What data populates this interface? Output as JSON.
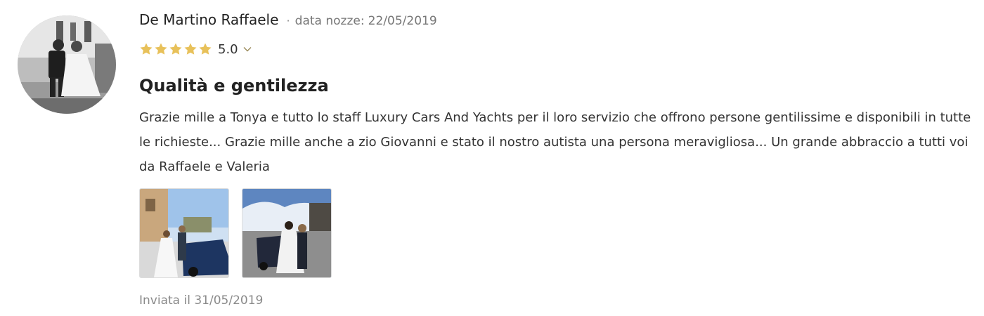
{
  "review": {
    "author": "De Martino Raffaele",
    "separator": "·",
    "wedding_label": "data nozze:",
    "wedding_date": "22/05/2019",
    "rating": "5.0",
    "stars": 5,
    "star_color": "#E8C15A",
    "title": "Qualità e gentilezza",
    "body": "Grazie mille a Tonya e tutto lo staff Luxury Cars And Yachts per il loro servizio che offrono persone gentilissime e disponibili in tutte le richieste... Grazie mille anche a zio Giovanni e stato il nostro autista una persona meravigliosa... Un grande abbraccio a tutti voi da Raffaele e Valeria",
    "sent_label": "Inviata il",
    "sent_date": "31/05/2019",
    "photos": [
      "wedding-couple-car-photo",
      "wedding-couple-street-photo"
    ],
    "avatar": "avatar-photo"
  },
  "icons": {
    "star": "star-icon",
    "chevron": "chevron-down-icon"
  }
}
